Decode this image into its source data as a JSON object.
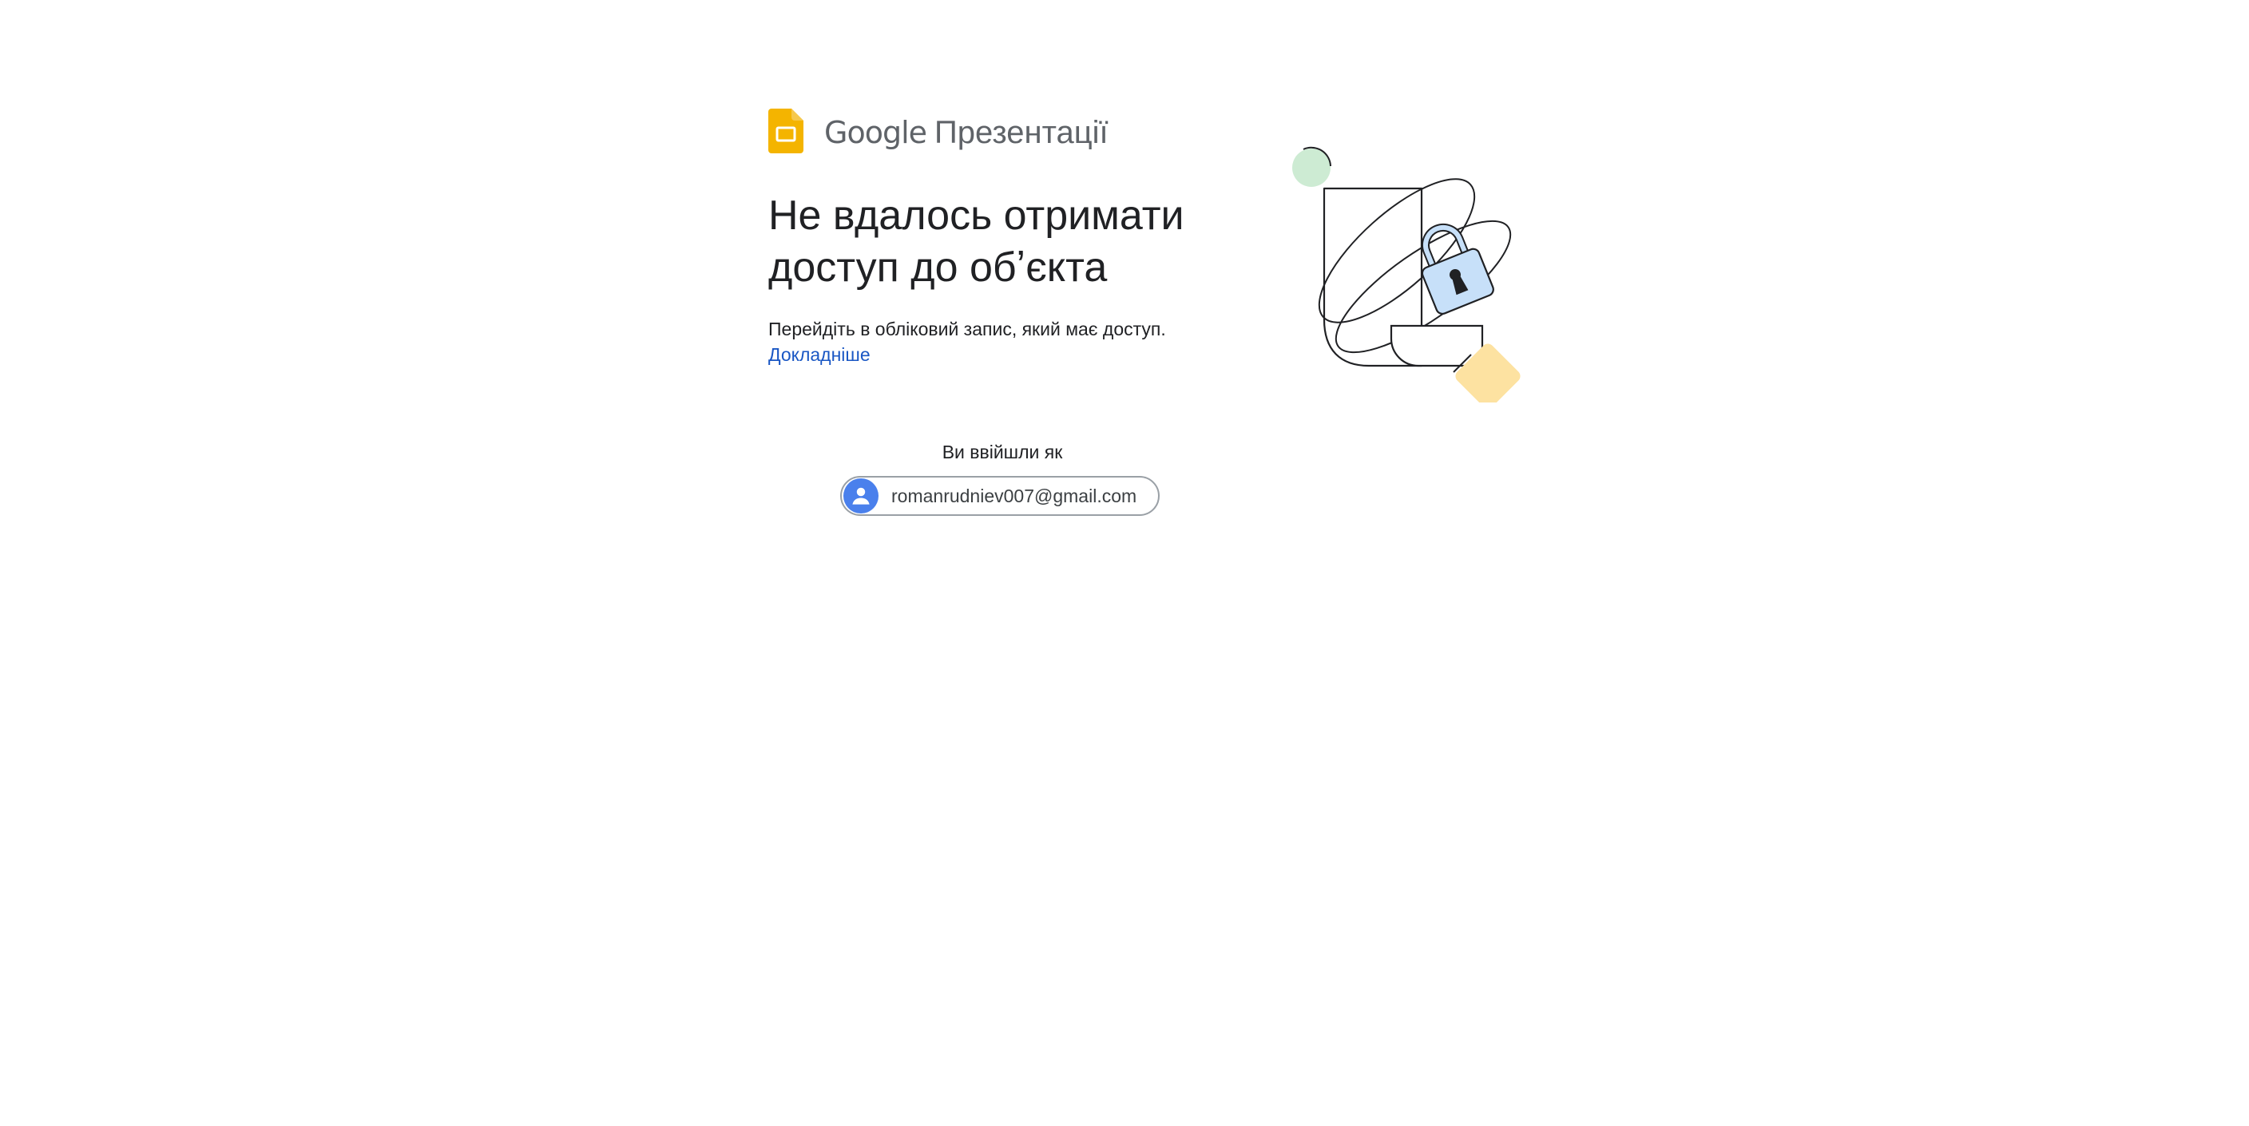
{
  "brand": {
    "google": "Google",
    "product": "Презентації",
    "logo_icon": "google-slides-icon",
    "logo_color": "#f4b400"
  },
  "error": {
    "title": "Не вдалось отримати доступ до обʼєкта",
    "message": "Перейдіть в обліковий запис, який має доступ.",
    "learn_more": "Докладніше"
  },
  "account": {
    "signed_in_label": "Ви ввійшли як",
    "email": "romanrudniev007@gmail.com",
    "avatar_icon": "person-icon",
    "avatar_color": "#4a80ec"
  },
  "illustration": {
    "icon": "padlock-icon",
    "colors": {
      "circle": "#cdebd3",
      "lock": "#c7e0f9",
      "diamond": "#fde2a1"
    }
  }
}
